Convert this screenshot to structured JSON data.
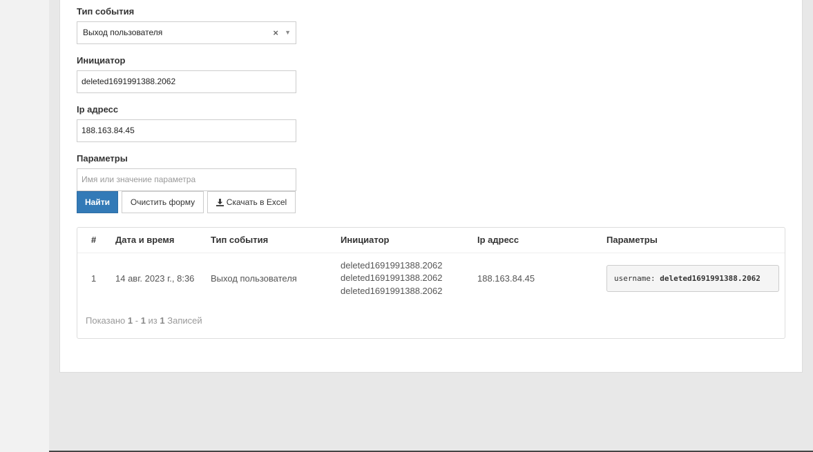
{
  "filter_form": {
    "event_type": {
      "label": "Тип события",
      "value": "Выход пользователя"
    },
    "initiator": {
      "label": "Инициатор",
      "value": "deleted1691991388.2062"
    },
    "ip_address": {
      "label": "Ip адресс",
      "value": "188.163.84.45"
    },
    "parameters": {
      "label": "Параметры",
      "placeholder": "Имя или значение параметра",
      "value": ""
    }
  },
  "buttons": {
    "find": "Найти",
    "clear": "Очистить форму",
    "excel": "Скачать в Excel"
  },
  "table": {
    "headers": [
      "#",
      "Дата и время",
      "Тип события",
      "Инициатор",
      "Ip адресс",
      "Параметры"
    ],
    "rows": [
      {
        "num": "1",
        "datetime": "14 авг. 2023 г., 8:36",
        "event_type": "Выход пользователя",
        "initiator_lines": [
          "deleted1691991388.2062",
          "deleted1691991388.2062",
          "deleted1691991388.2062"
        ],
        "ip": "188.163.84.45",
        "param_key": "username:",
        "param_value": "deleted1691991388.2062"
      }
    ]
  },
  "summary": {
    "prefix": "Показано",
    "from": "1",
    "dash": "-",
    "to": "1",
    "of": "из",
    "total": "1",
    "suffix": "Записей"
  },
  "colors": {
    "primary": "#337ab7",
    "background": "#e8e8e8",
    "panel": "#ffffff"
  },
  "icons": {
    "clear_select": "close-icon",
    "select_arrow": "caret-down-icon",
    "excel_button": "download-icon"
  }
}
